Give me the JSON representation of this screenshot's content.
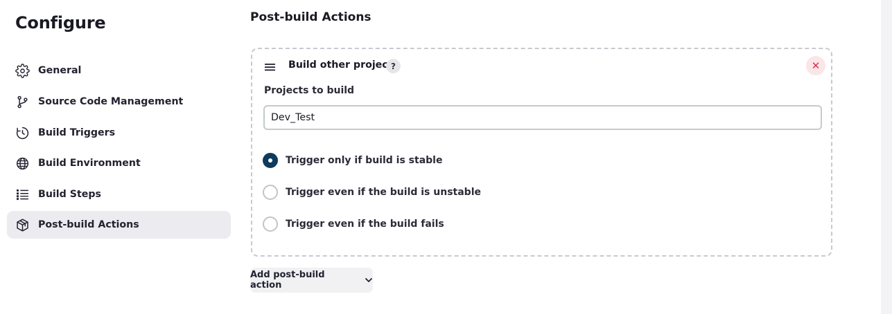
{
  "sidebar": {
    "title": "Configure",
    "items": [
      {
        "label": "General",
        "icon": "gear-icon",
        "active": false
      },
      {
        "label": "Source Code Management",
        "icon": "branch-icon",
        "active": false
      },
      {
        "label": "Build Triggers",
        "icon": "clock-icon",
        "active": false
      },
      {
        "label": "Build Environment",
        "icon": "globe-icon",
        "active": false
      },
      {
        "label": "Build Steps",
        "icon": "list-icon",
        "active": false
      },
      {
        "label": "Post-build Actions",
        "icon": "package-icon",
        "active": true
      }
    ]
  },
  "main": {
    "section_title": "Post-build Actions",
    "card": {
      "title": "Build other projects",
      "help_label": "?",
      "remove_label": "✕",
      "field_label": "Projects to build",
      "field_value": "Dev_Test",
      "options": [
        {
          "label": "Trigger only if build is stable",
          "checked": true
        },
        {
          "label": "Trigger even if the build is unstable",
          "checked": false
        },
        {
          "label": "Trigger even if the build fails",
          "checked": false
        }
      ]
    },
    "add_button_label": "Add post-build action"
  },
  "colors": {
    "accent": "#0e3b5c",
    "active_nav_bg": "#ebebf0",
    "remove_red": "#d2354b"
  }
}
